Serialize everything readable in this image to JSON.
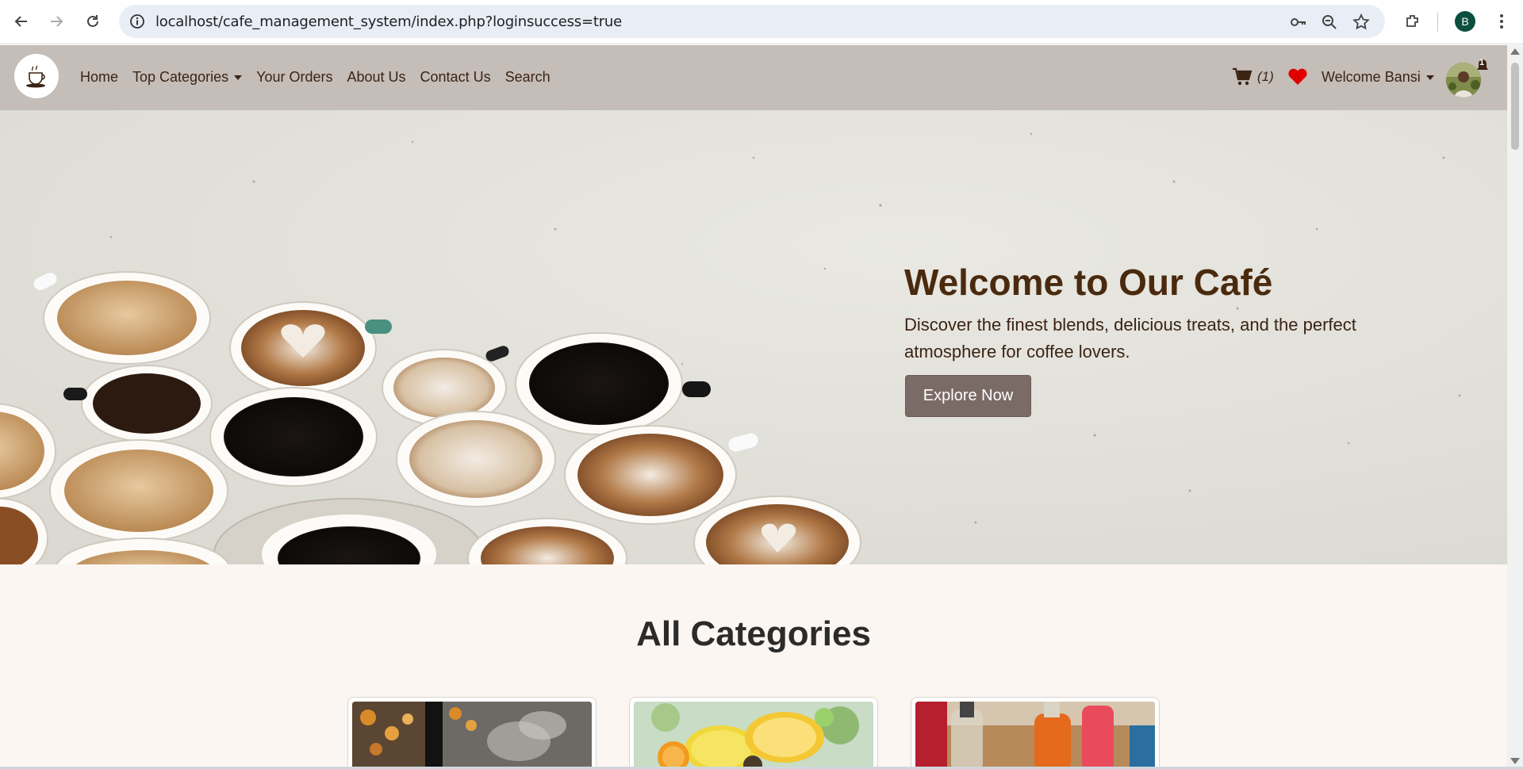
{
  "browser": {
    "url": "localhost/cafe_management_system/index.php?loginsuccess=true",
    "profile_initial": "B"
  },
  "navbar": {
    "links": [
      {
        "label": "Home"
      },
      {
        "label": "Top Categories",
        "dropdown": true
      },
      {
        "label": "Your Orders"
      },
      {
        "label": "About Us"
      },
      {
        "label": "Contact Us"
      },
      {
        "label": "Search"
      }
    ],
    "cart_count": "(1)",
    "welcome_label": "Welcome Bansi",
    "notification_count": "1"
  },
  "hero": {
    "title": "Welcome to Our Café",
    "subtitle": "Discover the finest blends, delicious treats, and the perfect atmosphere for coffee lovers.",
    "button_label": "Explore Now"
  },
  "categories": {
    "title": "All Categories"
  },
  "colors": {
    "navbar_bg": "#c4bdb8",
    "hero_title": "#4a2a0e",
    "button_bg": "#7b6b66",
    "page_bg": "#fcf6f2"
  }
}
